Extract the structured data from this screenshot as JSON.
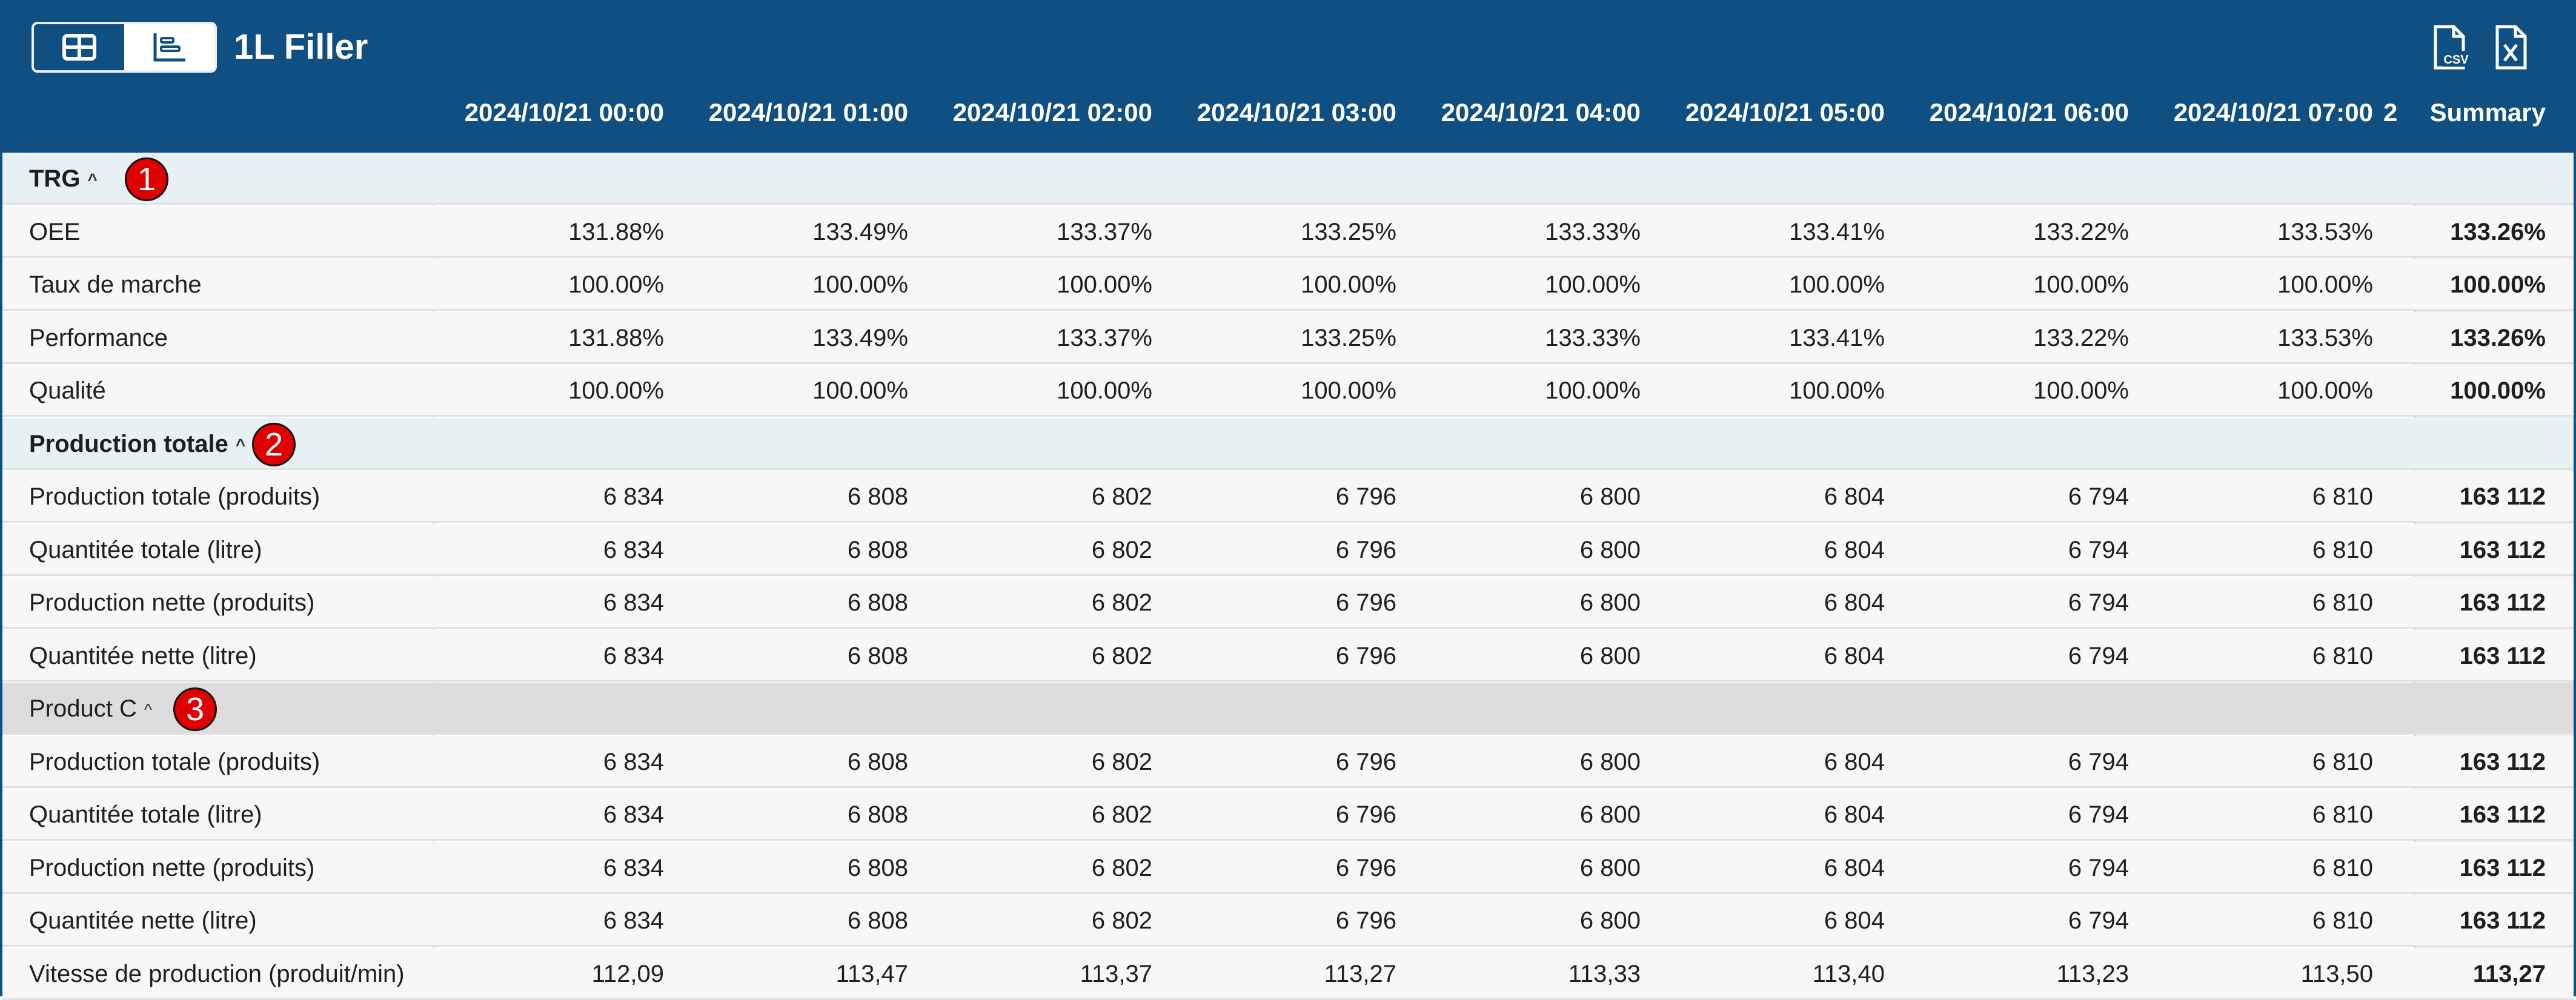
{
  "title": "1L Filler",
  "toolbar": {
    "view_icons": [
      "table-view-icon",
      "chart-view-icon"
    ],
    "export_icons": [
      "csv-export-icon",
      "excel-export-icon"
    ]
  },
  "columns": [
    "2024/10/21 00:00",
    "2024/10/21 01:00",
    "2024/10/21 02:00",
    "2024/10/21 03:00",
    "2024/10/21 04:00",
    "2024/10/21 05:00",
    "2024/10/21 06:00",
    "2024/10/21 07:00",
    "2",
    "Summary"
  ],
  "sections": [
    {
      "label": "TRG",
      "badge": "1",
      "rows": [
        {
          "label": "OEE",
          "values": [
            "131.88%",
            "133.49%",
            "133.37%",
            "133.25%",
            "133.33%",
            "133.41%",
            "133.22%",
            "133.53%"
          ],
          "summary": "133.26%"
        },
        {
          "label": "Taux de marche",
          "values": [
            "100.00%",
            "100.00%",
            "100.00%",
            "100.00%",
            "100.00%",
            "100.00%",
            "100.00%",
            "100.00%"
          ],
          "summary": "100.00%"
        },
        {
          "label": "Performance",
          "values": [
            "131.88%",
            "133.49%",
            "133.37%",
            "133.25%",
            "133.33%",
            "133.41%",
            "133.22%",
            "133.53%"
          ],
          "summary": "133.26%"
        },
        {
          "label": "Qualité",
          "values": [
            "100.00%",
            "100.00%",
            "100.00%",
            "100.00%",
            "100.00%",
            "100.00%",
            "100.00%",
            "100.00%"
          ],
          "summary": "100.00%"
        }
      ]
    },
    {
      "label": "Production totale",
      "badge": "2",
      "rows": [
        {
          "label": "Production totale (produits)",
          "values": [
            "6 834",
            "6 808",
            "6 802",
            "6 796",
            "6 800",
            "6 804",
            "6 794",
            "6 810"
          ],
          "summary": "163 112"
        },
        {
          "label": "Quantitée totale (litre)",
          "values": [
            "6 834",
            "6 808",
            "6 802",
            "6 796",
            "6 800",
            "6 804",
            "6 794",
            "6 810"
          ],
          "summary": "163 112"
        },
        {
          "label": "Production nette (produits)",
          "values": [
            "6 834",
            "6 808",
            "6 802",
            "6 796",
            "6 800",
            "6 804",
            "6 794",
            "6 810"
          ],
          "summary": "163 112"
        },
        {
          "label": "Quantitée nette (litre)",
          "values": [
            "6 834",
            "6 808",
            "6 802",
            "6 796",
            "6 800",
            "6 804",
            "6 794",
            "6 810"
          ],
          "summary": "163 112"
        }
      ]
    },
    {
      "label": "Product C",
      "badge": "3",
      "rows": [
        {
          "label": "Production totale (produits)",
          "values": [
            "6 834",
            "6 808",
            "6 802",
            "6 796",
            "6 800",
            "6 804",
            "6 794",
            "6 810"
          ],
          "summary": "163 112"
        },
        {
          "label": "Quantitée totale (litre)",
          "values": [
            "6 834",
            "6 808",
            "6 802",
            "6 796",
            "6 800",
            "6 804",
            "6 794",
            "6 810"
          ],
          "summary": "163 112"
        },
        {
          "label": "Production nette (produits)",
          "values": [
            "6 834",
            "6 808",
            "6 802",
            "6 796",
            "6 800",
            "6 804",
            "6 794",
            "6 810"
          ],
          "summary": "163 112"
        },
        {
          "label": "Quantitée nette (litre)",
          "values": [
            "6 834",
            "6 808",
            "6 802",
            "6 796",
            "6 800",
            "6 804",
            "6 794",
            "6 810"
          ],
          "summary": "163 112"
        },
        {
          "label": "Vitesse de production (produit/min)",
          "values": [
            "112,09",
            "113,47",
            "113,37",
            "113,27",
            "113,33",
            "113,40",
            "113,23",
            "113,50"
          ],
          "summary": "113,27"
        }
      ]
    }
  ]
}
